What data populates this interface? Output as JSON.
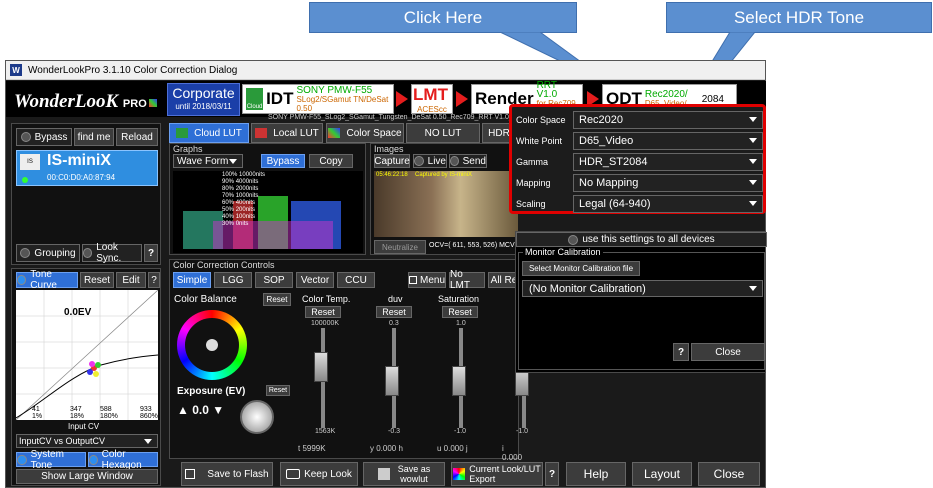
{
  "callouts": {
    "click_here": "Click Here",
    "select_hdr": "Select HDR Tone"
  },
  "window": {
    "title": "WonderLookPro 3.1.10 Color Correction Dialog",
    "icon": "W"
  },
  "logo": {
    "name": "WonderLooK",
    "suffix": "PRO"
  },
  "corporate": {
    "label": "Corporate",
    "until": "until 2018/03/11"
  },
  "pipeline": {
    "idt": {
      "label": "IDT",
      "l1": "SONY PMW-F55",
      "l2": "SLog2/SGamut TN/DeSat 0.50",
      "badge": "Cloud"
    },
    "lmt": {
      "label": "LMT",
      "sub": "ACEScc"
    },
    "render": {
      "label": "Render",
      "l1": "RRT V1.0",
      "l2": "for Rec709 1.00"
    },
    "odt": {
      "label": "ODT",
      "l1": "Rec2020/",
      "l2": "D65_Video/",
      "extra": "2084"
    },
    "desc": "SONY PMW-F55_SLog2_SGamut_Tungsten_DeSat 0.50_Rec709_RRT V1.0_Ne"
  },
  "device": {
    "bypass": "Bypass",
    "findme": "find me",
    "reload": "Reload",
    "name": "IS-miniX",
    "mac": "00:C0:D0:A0:87:94",
    "grouping": "Grouping",
    "looksync": "Look Sync.",
    "help": "?"
  },
  "tabs": {
    "cloud": "Cloud LUT",
    "local": "Local LUT",
    "colorspace": "Color Space",
    "nolut": "NO LUT",
    "hdr": "HDR"
  },
  "graphs": {
    "title": "Graphs",
    "mode": "Wave Form",
    "bypass": "Bypass",
    "copy": "Copy",
    "labels": [
      "10000nits",
      "4000nits",
      "2000nits",
      "1000nits",
      "400nits",
      "200nits",
      "100nits",
      "0nits"
    ],
    "pcts": [
      "100%",
      "90%",
      "80%",
      "70%",
      "60%",
      "50%",
      "40%",
      "30%"
    ]
  },
  "images": {
    "title": "Images",
    "capture": "Capture",
    "live": "Live",
    "send": "Send",
    "stamp": "05:46:22:18",
    "captured": "Captured by IS-miniX",
    "neutralize": "Neutralize",
    "ocv": "OCV=( 611, 553, 526) MCV="
  },
  "curve": {
    "tone": "Tone Curve",
    "reset": "Reset",
    "edit": "Edit",
    "help": "?",
    "ev": "0.0EV",
    "ticks": [
      "41",
      "347",
      "588",
      "933"
    ],
    "pcts": [
      "1%",
      "18%",
      "180%",
      "860%"
    ],
    "xlabel": "Input CV",
    "mode": "InputCV vs OutputCV",
    "systemtone": "System Tone",
    "colorhex": "Color Hexagon",
    "large": "Show Large Window"
  },
  "cc": {
    "title": "Color Correction Controls",
    "tabs": [
      "Simple",
      "LGG",
      "SOP",
      "Vector",
      "CCU"
    ],
    "menu": "Menu",
    "nolmt": "No LMT",
    "allreset": "All Re",
    "balance": "Color Balance",
    "reset": "Reset",
    "sliders": [
      {
        "name": "Color Temp.",
        "top": "100000K",
        "bottom": "1563K",
        "value": "t 5999K"
      },
      {
        "name": "duv",
        "top": "0.3",
        "bottom": "-0.3",
        "value": "y 0.000 h"
      },
      {
        "name": "Saturation",
        "top": "1.0",
        "bottom": "-1.0",
        "value": "u 0.000 j"
      },
      {
        "name": "",
        "top": "",
        "bottom": "-1.0",
        "value": "i 0.000 k"
      }
    ],
    "exposure": "Exposure (EV)",
    "exposure_value": "0.0"
  },
  "hdr": {
    "rows": [
      {
        "label": "Color Space",
        "value": "Rec2020"
      },
      {
        "label": "White Point",
        "value": "D65_Video"
      },
      {
        "label": "Gamma",
        "value": "HDR_ST2084"
      },
      {
        "label": "Mapping",
        "value": "No Mapping"
      },
      {
        "label": "Scaling",
        "value": "Legal (64-940)"
      }
    ],
    "all_devices": "use this settings to all devices",
    "monitor_title": "Monitor Calibration",
    "select_file": "Select Monitor Calibration file",
    "calibration": "(No Monitor Calibration)",
    "help": "?",
    "close": "Close"
  },
  "bottom": {
    "save_flash": "Save to Flash",
    "keep": "Keep Look",
    "save_as": "Save as",
    "wowlut": "wowlut",
    "export1": "Current Look/LUT",
    "export2": "Export",
    "help_q": "?",
    "help": "Help",
    "layout": "Layout",
    "close": "Close"
  }
}
